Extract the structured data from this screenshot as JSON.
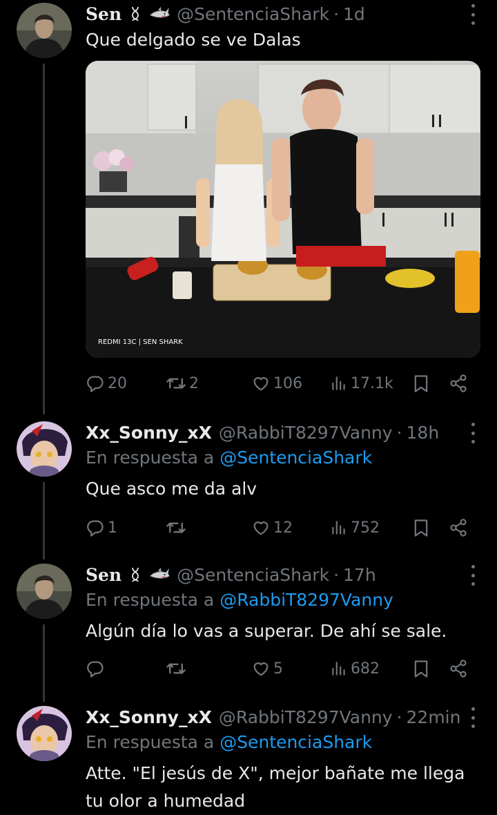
{
  "tweets": [
    {
      "name": "Sen",
      "handle": "@SentenciaShark",
      "time": "1d",
      "reply_prefix": "",
      "reply_handle": "",
      "text": "Que delgado se ve Dalas",
      "media_watermark": "REDMI 13C | SEN SHARK",
      "stats": {
        "replies": "20",
        "reposts": "2",
        "likes": "106",
        "views": "17.1k"
      }
    },
    {
      "name": "Xx_Sonny_xX",
      "handle": "@RabbiT8297Vanny",
      "time": "18h",
      "reply_prefix": "En respuesta a ",
      "reply_handle": "@SentenciaShark",
      "text": "Que asco me da alv",
      "stats": {
        "replies": "1",
        "reposts": "",
        "likes": "12",
        "views": "752"
      }
    },
    {
      "name": "Sen",
      "handle": "@SentenciaShark",
      "time": "17h",
      "reply_prefix": "En respuesta a ",
      "reply_handle": "@RabbiT8297Vanny",
      "text": "Algún día lo vas a superar. De ahí se sale.",
      "stats": {
        "replies": "",
        "reposts": "",
        "likes": "5",
        "views": "682"
      }
    },
    {
      "name": "Xx_Sonny_xX",
      "handle": "@RabbiT8297Vanny",
      "time": "22min",
      "reply_prefix": "En respuesta a ",
      "reply_handle": "@SentenciaShark",
      "text": "Atte. \"El jesús de X\", mejor bañate me llega tu olor a humedad"
    }
  ],
  "colors": {
    "background": "#000000",
    "text": "#e7e9ea",
    "muted": "#71767b",
    "link": "#1d9bf0",
    "line": "#333639"
  },
  "icons": [
    "reply-icon",
    "repost-icon",
    "like-icon",
    "views-icon",
    "bookmark-icon",
    "share-icon",
    "more-icon",
    "dna-emoji",
    "shark-emoji"
  ]
}
